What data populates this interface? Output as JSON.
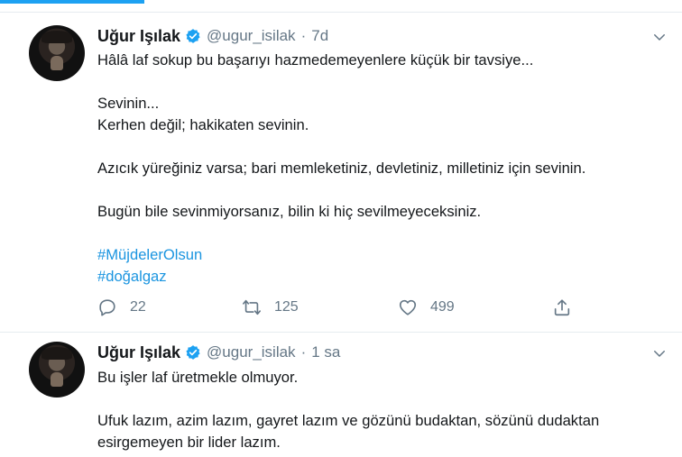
{
  "tweets": [
    {
      "name": "Uğur Işılak",
      "handle": "@ugur_isilak",
      "time": "7d",
      "lines": [
        "Hâlâ laf sokup bu başarıyı hazmedemeyenlere küçük bir tavsiye...",
        "",
        "Sevinin...",
        "Kerhen değil; hakikaten sevinin.",
        "",
        "Azıcık yüreğiniz varsa; bari memleketiniz, devletiniz, milletiniz için sevinin.",
        "",
        "Bugün bile sevinmiyorsanız, bilin ki hiç sevilmeyeceksiniz."
      ],
      "hashtags": [
        "#MüjdelerOlsun",
        "#doğalgaz"
      ],
      "reply_count": "22",
      "retweet_count": "125",
      "like_count": "499"
    },
    {
      "name": "Uğur Işılak",
      "handle": "@ugur_isilak",
      "time": "1 sa",
      "lines": [
        "Bu işler laf üretmekle olmuyor.",
        "",
        "Ufuk lazım, azim lazım, gayret lazım ve gözünü budaktan, sözünü dudaktan",
        "esirgemeyen bir lider lazım."
      ]
    }
  ],
  "colors": {
    "accent": "#1da1f2",
    "hashtag": "#1b95e0",
    "muted": "#657786",
    "text": "#14171a"
  },
  "icons": [
    "verified-badge-icon",
    "chevron-down-icon",
    "reply-icon",
    "retweet-icon",
    "like-icon",
    "share-icon"
  ]
}
